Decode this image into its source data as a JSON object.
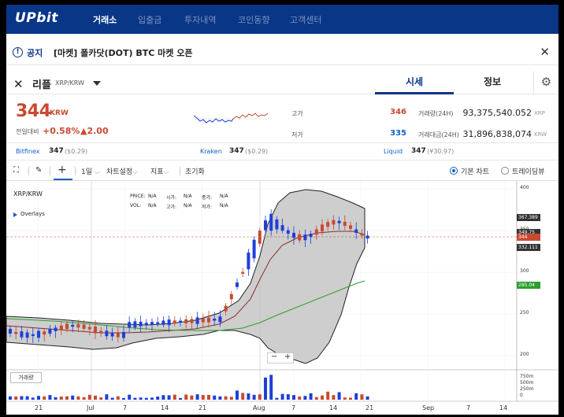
{
  "nav": {
    "logo": "UPbit",
    "items": [
      "거래소",
      "입출금",
      "투자내역",
      "코인동향",
      "고객센터"
    ]
  },
  "notice": {
    "label": "공지",
    "text": "[마켓] 폴카닷(DOT) BTC 마켓 오픈",
    "close": "✕"
  },
  "coin": {
    "name": "리플",
    "pair": "XRP/KRW",
    "tabs": [
      "시세",
      "정보"
    ]
  },
  "summary": {
    "price": "344",
    "unit": "KRW",
    "change_label": "전일대비",
    "change_rate": "+0.58%",
    "change_amount": "▲2.00",
    "high_label": "고가",
    "high": "346",
    "low_label": "저가",
    "low": "335",
    "volume_label": "거래량(24H)",
    "volume": "93,375,540.052",
    "volume_unit": "XRP",
    "value_label": "거래대금(24H)",
    "value": "31,896,838,074",
    "value_unit": "KRW"
  },
  "exchanges": [
    {
      "name": "Bitfinex",
      "price": "347",
      "diff": "($0.29)"
    },
    {
      "name": "Kraken",
      "price": "347",
      "diff": "($0.29)"
    },
    {
      "name": "Liquid",
      "price": "347",
      "diff": "(¥30.97)"
    }
  ],
  "toolbar": {
    "period": "1일",
    "chart_settings": "차트설정",
    "indicators": "지표",
    "reset": "초기화",
    "basic_chart": "기본 차트",
    "tradingview": "트레이딩뷰"
  },
  "chart": {
    "symbol": "XRP/KRW",
    "overlays": "Overlays",
    "ohlc": {
      "price_l": "PRICE:",
      "price": "N/A",
      "vol_l": "VOL:",
      "vol": "N/A",
      "open_l": "시가:",
      "open": "N/A",
      "high_l": "고가:",
      "high": "N/A",
      "close_l": "종가:",
      "close": "N/A",
      "low_l": "저가:",
      "low": "N/A"
    },
    "volume_button": "거래량",
    "zoom_minus": "−",
    "zoom_plus": "+"
  },
  "chart_data": {
    "type": "candlestick",
    "x_ticks": [
      "21",
      "Jul",
      "7",
      "14",
      "21",
      "Aug",
      "7",
      "14",
      "21",
      "Sep",
      "7",
      "14"
    ],
    "y_ticks": [
      400,
      350,
      300,
      250,
      200
    ],
    "volume_ticks": [
      "750m",
      "500m",
      "250m",
      "0"
    ],
    "price_tags": [
      {
        "label": "367.389",
        "color": "#333333"
      },
      {
        "label": "349.75",
        "color": "#333333"
      },
      {
        "label": "344",
        "color": "#c84a31"
      },
      {
        "label": "332.111",
        "color": "#333333"
      },
      {
        "label": "285.04",
        "color": "#2e9e2e"
      }
    ],
    "colors": {
      "up": "#c84a31",
      "down": "#1e3fd8",
      "ma_red": "#8b2d2d",
      "ma_green": "#2e9e2e",
      "band_fill": "#bdbdbd"
    }
  }
}
